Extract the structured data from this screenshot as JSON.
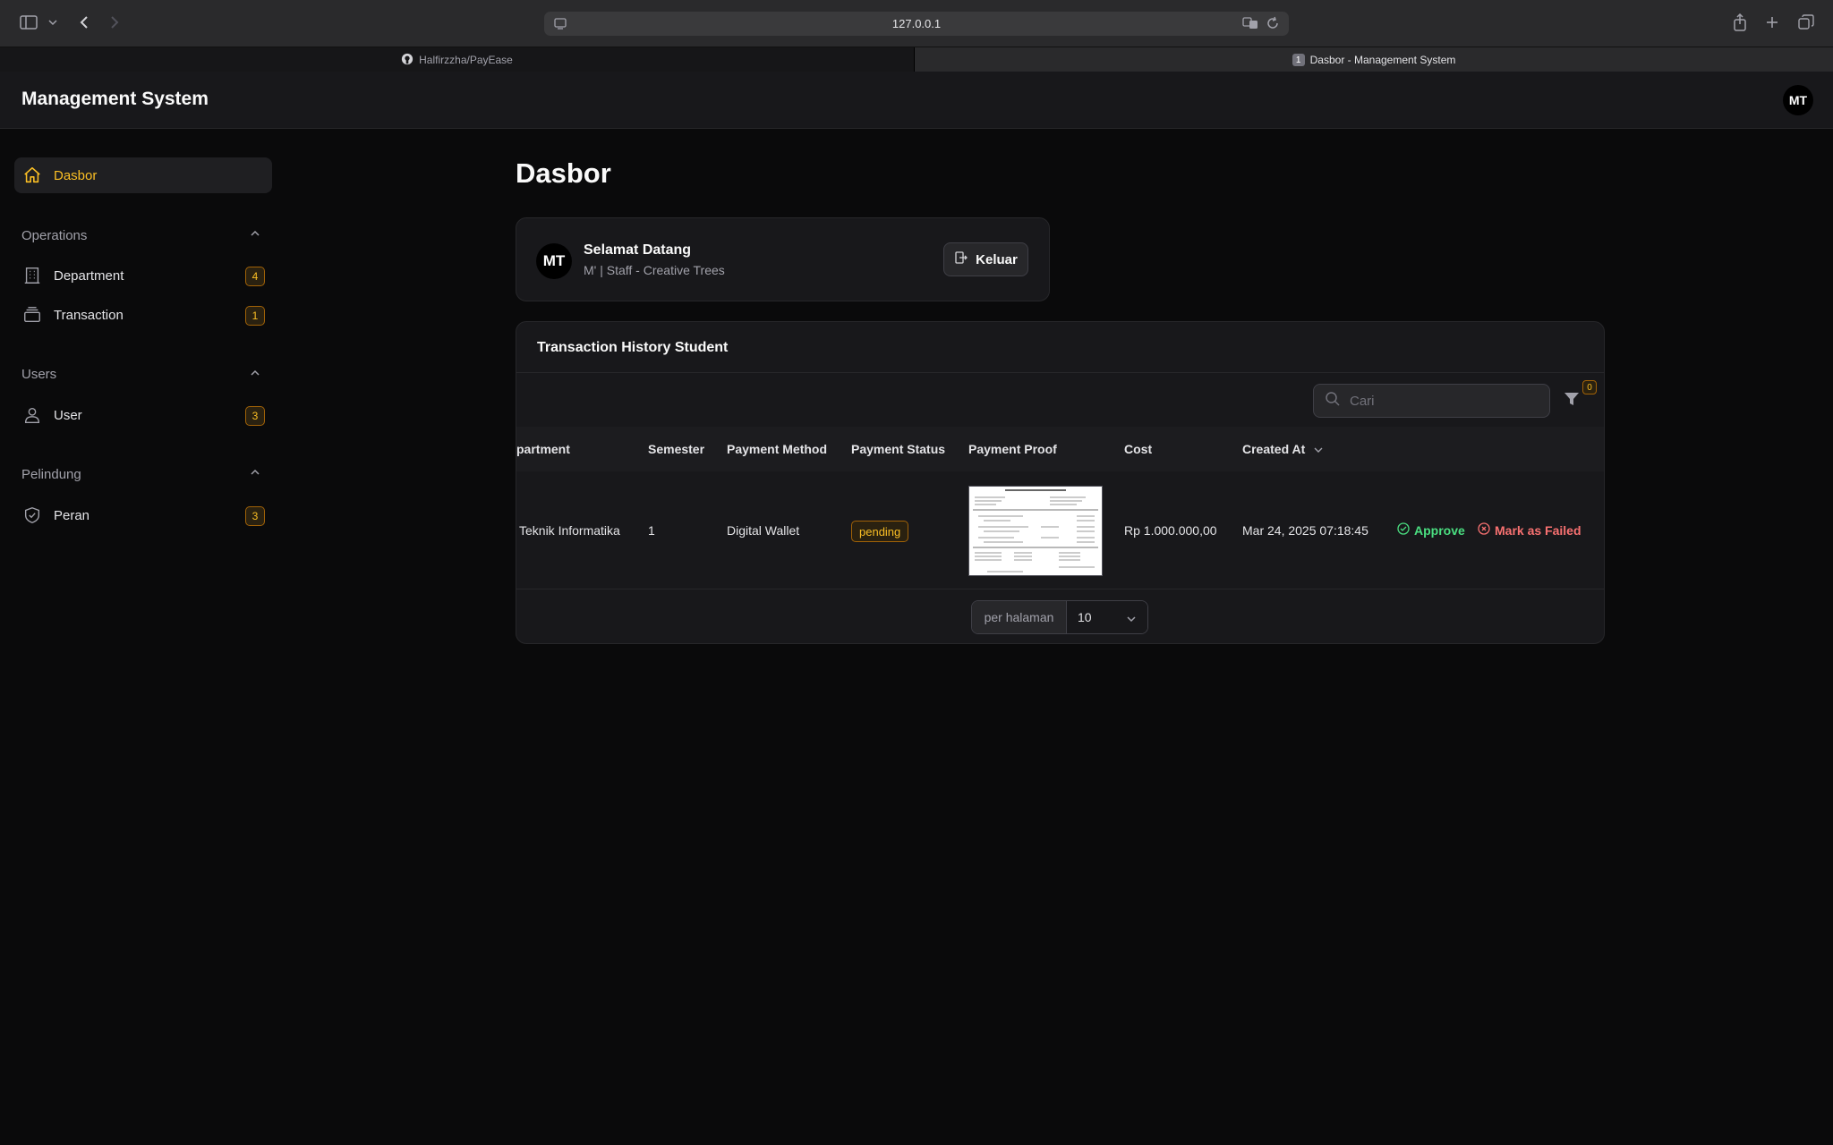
{
  "browser": {
    "url": "127.0.0.1",
    "tabs": [
      {
        "label": "Halfirzzha/PayEase",
        "active": false
      },
      {
        "label": "Dasbor - Management System",
        "active": true,
        "badge": "1"
      }
    ]
  },
  "app": {
    "brand": "Management System",
    "user_initials": "MT"
  },
  "sidebar": {
    "dashboard": "Dasbor",
    "groups": [
      {
        "label": "Operations",
        "items": [
          {
            "label": "Department",
            "badge": "4",
            "icon": "building-icon"
          },
          {
            "label": "Transaction",
            "badge": "1",
            "icon": "inbox-stack-icon"
          }
        ]
      },
      {
        "label": "Users",
        "items": [
          {
            "label": "User",
            "badge": "3",
            "icon": "user-icon"
          }
        ]
      },
      {
        "label": "Pelindung",
        "items": [
          {
            "label": "Peran",
            "badge": "3",
            "icon": "shield-check-icon"
          }
        ]
      }
    ]
  },
  "main": {
    "title": "Dasbor",
    "welcome": {
      "initials": "MT",
      "title": "Selamat Datang",
      "subtitle": "M' | Staff - Creative Trees",
      "logout": "Keluar"
    },
    "table": {
      "heading": "Transaction History Student",
      "search_placeholder": "Cari",
      "filter_count": "0",
      "columns": [
        "partment",
        "Semester",
        "Payment Method",
        "Payment Status",
        "Payment Proof",
        "Cost",
        "Created At"
      ],
      "row": {
        "department": "Teknik Informatika",
        "semester": "1",
        "payment_method": "Digital Wallet",
        "payment_status": "pending",
        "cost": "Rp 1.000.000,00",
        "created_at": "Mar 24, 2025 07:18:45",
        "approve": "Approve",
        "fail": "Mark as Failed"
      },
      "pagination": {
        "label": "per halaman",
        "value": "10"
      }
    }
  },
  "colors": {
    "accent": "#fbbf24",
    "approve": "#4ade80",
    "fail": "#f87171"
  }
}
